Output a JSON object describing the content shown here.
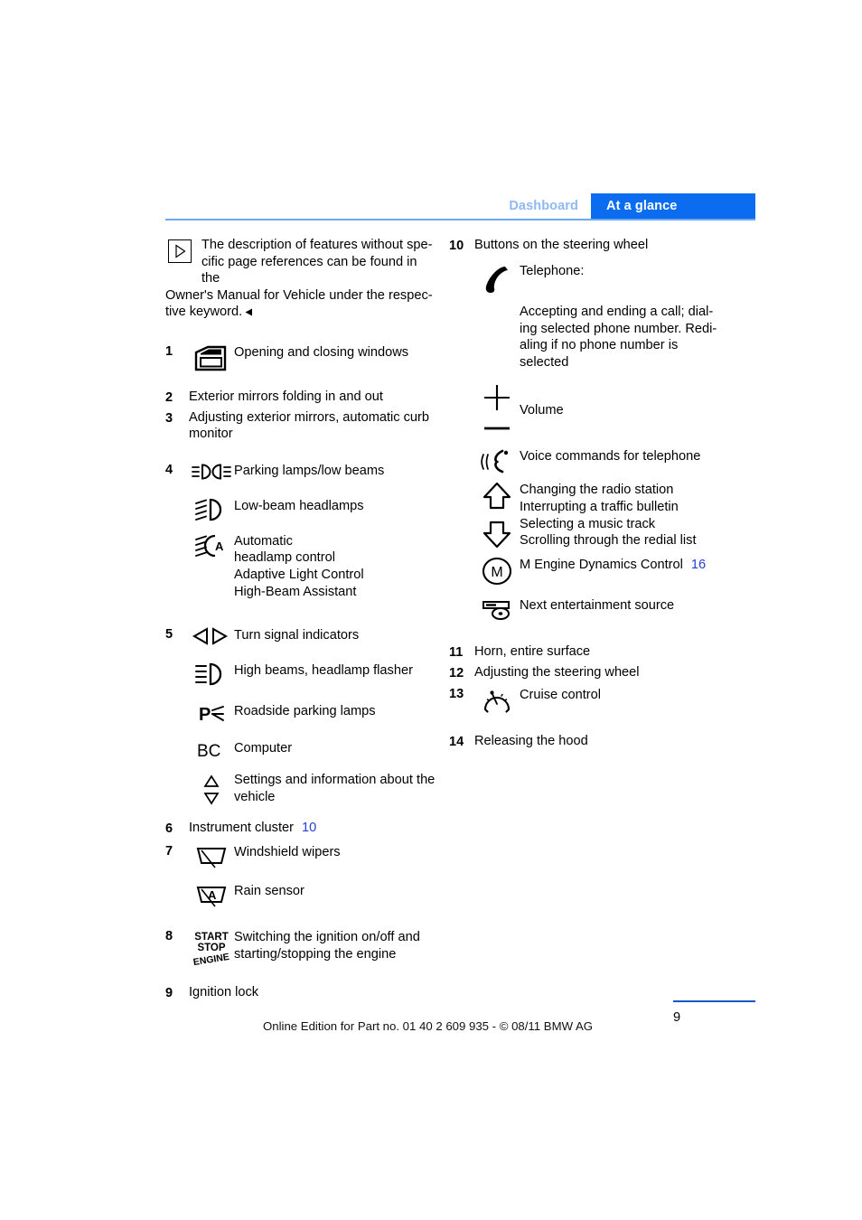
{
  "header": {
    "breadcrumb_inactive": "Dashboard",
    "breadcrumb_active": "At a glance",
    "accent_color": "#0b6cf0",
    "inactive_color": "#8fb9f2",
    "rule_color": "#6ea8f0"
  },
  "note": {
    "text": "The description of features without specific page references can be found in the Owner's Manual for Vehicle under the respective keyword.",
    "line1": "The description of features without spe-",
    "line2": "cific page references can be found in the",
    "line3": "Owner's Manual for Vehicle under the respec-",
    "line4": "tive keyword."
  },
  "left_column": [
    {
      "number": "1",
      "icon": "car-door-window-icon",
      "label": "Opening and closing windows"
    },
    {
      "number": "2",
      "label": "Exterior mirrors folding in and out"
    },
    {
      "number": "3",
      "label": "Adjusting exterior mirrors, automatic curb monitor",
      "line1": "Adjusting exterior mirrors, automatic curb",
      "line2": "monitor"
    },
    {
      "number": "4",
      "sub_items": [
        {
          "icon": "parking-lamps-low-beams-icon",
          "label": "Parking lamps/low beams"
        },
        {
          "icon": "low-beam-headlamps-icon",
          "label": "Low-beam headlamps"
        },
        {
          "icon": "automatic-headlamp-control-icon",
          "label": "Automatic headlamp control Adaptive Light Control High-Beam Assistant",
          "line1": "Automatic",
          "line2": "headlamp control",
          "line3": "Adaptive Light Control",
          "line4": "High-Beam Assistant"
        }
      ]
    },
    {
      "number": "5",
      "sub_items": [
        {
          "icon": "turn-signal-indicators-icon",
          "label": "Turn signal indicators"
        },
        {
          "icon": "high-beams-flasher-icon",
          "label": "High beams, headlamp flasher"
        },
        {
          "icon": "roadside-parking-lamps-icon",
          "label": "Roadside parking lamps"
        },
        {
          "icon": "computer-bc-icon",
          "label": "Computer"
        },
        {
          "icon": "up-down-triangles-icon",
          "label": "Settings and information about the vehicle",
          "line1": "Settings and information about the",
          "line2": "vehicle"
        }
      ]
    },
    {
      "number": "6",
      "label": "Instrument cluster",
      "page_ref": "10"
    },
    {
      "number": "7",
      "sub_items": [
        {
          "icon": "windshield-wipers-icon",
          "label": "Windshield wipers"
        },
        {
          "icon": "rain-sensor-icon",
          "label": "Rain sensor"
        }
      ]
    },
    {
      "number": "8",
      "icon": "start-stop-engine-icon",
      "label": "Switching the ignition on/off and starting/stopping the engine",
      "line1": "Switching the ignition on/off and",
      "line2": "starting/stopping the engine"
    },
    {
      "number": "9",
      "label": "Ignition lock"
    }
  ],
  "right_column": [
    {
      "number": "10",
      "label": "Buttons on the steering wheel",
      "sub_items": [
        {
          "icon": "telephone-handset-icon",
          "label": "Telephone:",
          "detail": "Accepting and ending a call; dialing selected phone number. Redialing if no phone number is selected",
          "detail_line1": "Accepting and ending a call; dial-",
          "detail_line2": "ing selected phone number. Redi-",
          "detail_line3": "aling if no phone number is",
          "detail_line4": "selected"
        },
        {
          "icon": "volume-plus-minus-icon",
          "label": "Volume"
        },
        {
          "icon": "voice-command-icon",
          "label": "Voice commands for telephone"
        },
        {
          "icon": "up-down-arrows-icon",
          "label": "Changing the radio station Interrupting a traffic bulletin Selecting a music track Scrolling through the redial list",
          "line1": "Changing the radio station",
          "line2": "Interrupting a traffic bulletin",
          "line3": "Selecting a music track",
          "line4": "Scrolling through the redial list"
        },
        {
          "icon": "m-circle-icon",
          "label": "M Engine Dynamics Control",
          "page_ref": "16"
        },
        {
          "icon": "entertainment-source-icon",
          "label": "Next entertainment source"
        }
      ]
    },
    {
      "number": "11",
      "label": "Horn, entire surface"
    },
    {
      "number": "12",
      "label": "Adjusting the steering wheel"
    },
    {
      "number": "13",
      "icon": "cruise-control-gauge-icon",
      "label": "Cruise control"
    },
    {
      "number": "14",
      "label": "Releasing the hood"
    }
  ],
  "footer": {
    "edition_text": "Online Edition for Part no. 01 40 2 609 935 - © 08/11 BMW AG",
    "page_number": "9",
    "rule_color": "#1259c4"
  }
}
